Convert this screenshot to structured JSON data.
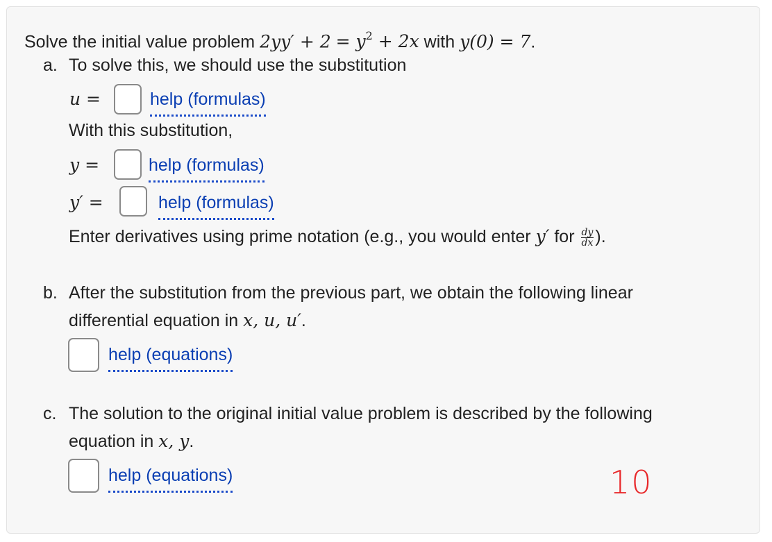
{
  "problem": {
    "intro": "Solve the initial value problem",
    "equation_lhs": "2yy′ + 2",
    "equation_rhs_pre": "= y",
    "equation_rhs_post": " + 2x",
    "with": "with",
    "initial_condition": "y(0) = 7",
    "period": "."
  },
  "part_a": {
    "marker": "a.",
    "text": "To solve this, we should use the substitution",
    "u_label": "u =",
    "help_u": "help (formulas)",
    "with_sub": "With this substitution,",
    "y_label": "y =",
    "help_y": "help (formulas)",
    "yprime_label": "y′ =",
    "help_yprime": "help (formulas)",
    "note_pre": "Enter derivatives using prime notation (e.g., you would enter",
    "note_var": "y′",
    "note_for": "for",
    "frac_num": "dy",
    "frac_den": "dx",
    "note_post": ")."
  },
  "part_b": {
    "marker": "b.",
    "line1": "After the substitution from the previous part, we obtain the following linear",
    "line2_pre": "differential equation in",
    "line2_vars": "x, u, u′",
    "line2_post": ".",
    "help": "help (equations)"
  },
  "part_c": {
    "marker": "c.",
    "line1": "The solution to the original initial value problem is described by the following",
    "line2_pre": "equation in",
    "line2_vars": "x, y",
    "line2_post": ".",
    "help": "help (equations)"
  },
  "score": "10",
  "colors": {
    "link": "#0b3fb3",
    "score": "#e8282a"
  }
}
